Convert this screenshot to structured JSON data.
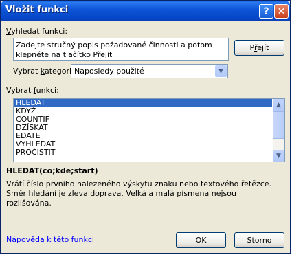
{
  "window": {
    "title": "Vložit funkci",
    "help_glyph": "?",
    "close_glyph": "✕"
  },
  "search": {
    "label_prefix": "",
    "label_accel": "V",
    "label_rest": "yhledat funkci:",
    "description": "Zadejte stručný popis požadované činnosti a potom klepněte na tlačítko Přejít",
    "go_prefix": "P",
    "go_accel": "ř",
    "go_rest": "ejít"
  },
  "category": {
    "label_prefix": "Vybrat ",
    "label_accel": "k",
    "label_rest": "ategorii:",
    "selected": "Naposledy použité",
    "arrow_icon": "chevron-down-icon"
  },
  "functions": {
    "label_prefix": "Vybrat ",
    "label_accel": "f",
    "label_rest": "unkci:",
    "items": [
      "HLEDAT",
      "KDYŽ",
      "COUNTIF",
      "DZÍSKAT",
      "EDATE",
      "VYHLEDAT",
      "PROČISTIT"
    ],
    "selected_index": 0,
    "signature": "HLEDAT(co;kde;start)",
    "description": "Vrátí číslo prvního nalezeného výskytu znaku nebo textového řetězce. Směr hledání je zleva doprava. Velká a malá písmena nejsou rozlišována."
  },
  "footer": {
    "help_link": "Nápověda k této funkci",
    "ok_label": "OK",
    "cancel_label": "Storno"
  }
}
